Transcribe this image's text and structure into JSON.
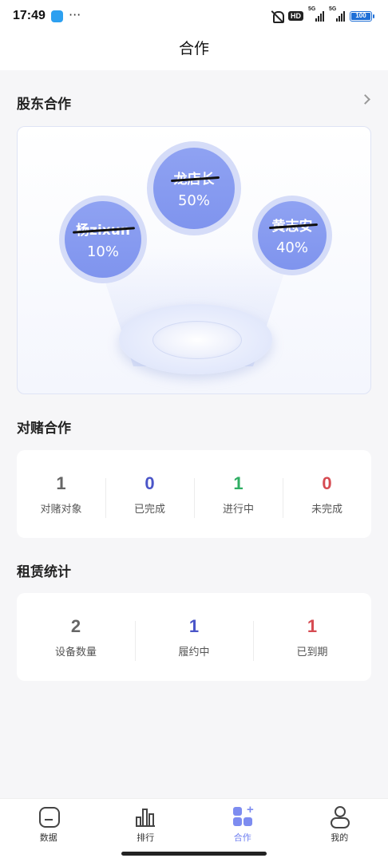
{
  "status_bar": {
    "time": "17:49",
    "more": "···",
    "hd": "HD",
    "signal1": "5G",
    "signal2": "5G",
    "battery": "100"
  },
  "header": {
    "title": "合作"
  },
  "shareholder": {
    "title": "股东合作",
    "members": [
      {
        "name": "杨zixun",
        "percent": "10%"
      },
      {
        "name": "龙店长",
        "percent": "50%"
      },
      {
        "name": "黄志安",
        "percent": "40%"
      }
    ]
  },
  "gamble": {
    "title": "对赌合作",
    "stats": [
      {
        "value": "1",
        "label": "对赌对象",
        "color": "#666666"
      },
      {
        "value": "0",
        "label": "已完成",
        "color": "#4a55c8"
      },
      {
        "value": "1",
        "label": "进行中",
        "color": "#2fae63"
      },
      {
        "value": "0",
        "label": "未完成",
        "color": "#d64b52"
      }
    ]
  },
  "lease": {
    "title": "租赁统计",
    "stats": [
      {
        "value": "2",
        "label": "设备数量",
        "color": "#666666"
      },
      {
        "value": "1",
        "label": "履约中",
        "color": "#4a55c8"
      },
      {
        "value": "1",
        "label": "已到期",
        "color": "#d64b52"
      }
    ]
  },
  "nav": {
    "items": [
      {
        "label": "数据",
        "icon": "data-icon"
      },
      {
        "label": "排行",
        "icon": "bar-chart-icon"
      },
      {
        "label": "合作",
        "icon": "cooperation-icon"
      },
      {
        "label": "我的",
        "icon": "profile-icon"
      }
    ],
    "active_color": "#6f7ff0"
  }
}
